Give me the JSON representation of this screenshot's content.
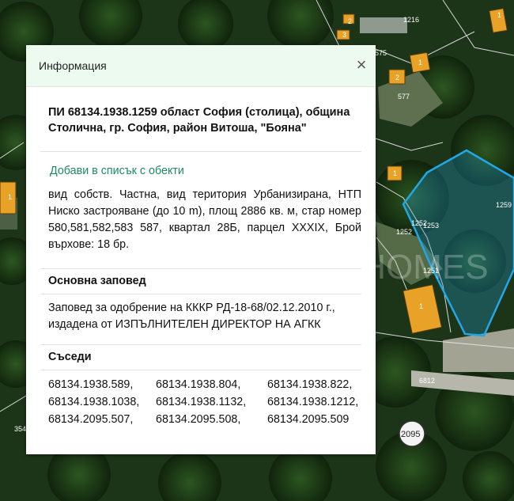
{
  "map": {
    "labels": [
      "1216",
      "2",
      "3",
      "575",
      "1",
      "577",
      "2",
      "1",
      "1252",
      "1253",
      "1259",
      "1252",
      "1251",
      "1",
      "1",
      "1",
      "6812",
      "354",
      "2095"
    ],
    "watermark": "CLOUD HOMES",
    "parcel_outline_color": "#22a7e6"
  },
  "popup": {
    "title": "Информация",
    "close_icon": "×",
    "parcel_title": "ПИ 68134.1938.1259 област София (столица), община Столична, гр. София, район Витоша, \"Бояна\"",
    "add_link": "Добави в списък с обекти",
    "description": "вид собств. Частна, вид територия Урбанизирана, НТП Ниско застрояване (до 10 m), площ 2886 кв. м, стар номер 580,581,582,583 587, квартал 28Б, парцел XXXIX, Брой върхове: 18 бр.",
    "order_heading": "Основна заповед",
    "order_text": "Заповед за одобрение на КККР РД-18-68/02.12.2010 г., издадена от ИЗПЪЛНИТЕЛЕН ДИРЕКТОР НА АГКК",
    "neighbors_heading": "Съседи",
    "neighbors": [
      "68134.1938.589,",
      "68134.1938.804,",
      "68134.1938.822,",
      "68134.1938.1038,",
      "68134.1938.1132,",
      "68134.1938.1212,",
      "68134.2095.507,",
      "68134.2095.508,",
      "68134.2095.509"
    ]
  }
}
